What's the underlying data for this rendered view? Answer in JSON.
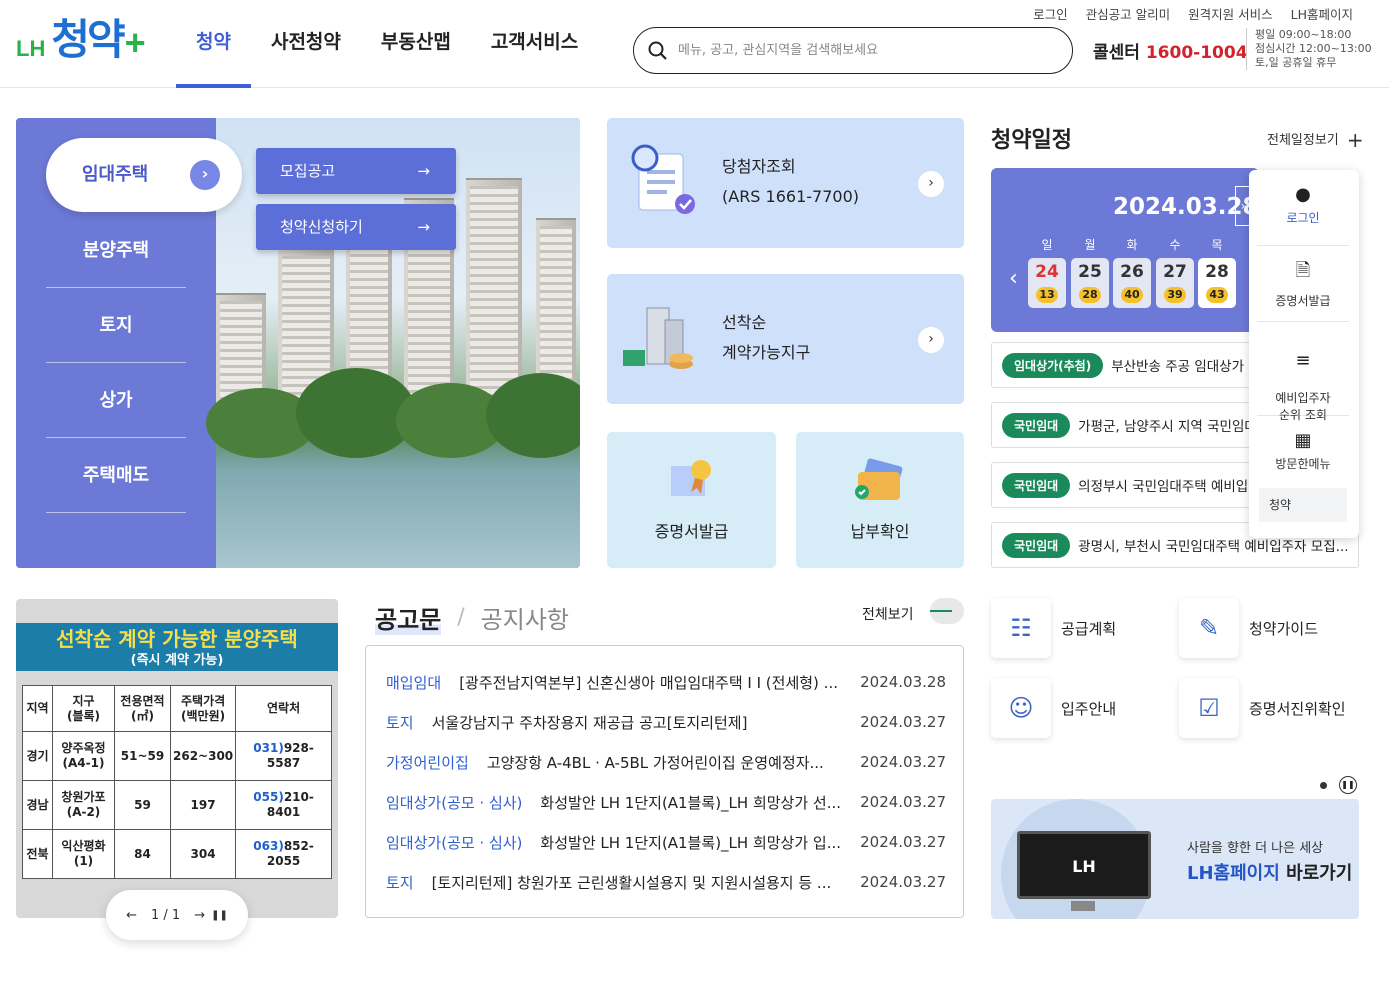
{
  "header": {
    "logo": {
      "prefix": "LH",
      "title": "청약",
      "suffix": "+"
    },
    "nav": [
      "청약",
      "사전청약",
      "부동산맵",
      "고객서비스"
    ],
    "util_links": [
      "로그인",
      "관심공고 알리미",
      "원격지원 서비스",
      "LH홈페이지"
    ],
    "search_placeholder": "메뉴, 공고, 관심지역을 검색해보세요",
    "callcenter_label": "콜센터",
    "callcenter_number": "1600-1004",
    "hours": [
      "평일 09:00~18:00",
      "점심시간 12:00~13:00",
      "토,일 공휴일 휴무"
    ]
  },
  "hero": {
    "tabs": [
      "임대주택",
      "분양주택",
      "토지",
      "상가",
      "주택매도"
    ],
    "buttons": [
      "모집공고",
      "청약신청하기"
    ],
    "arrow": "→",
    "chevron": "›"
  },
  "quick": {
    "winner": {
      "line1": "당첨자조회",
      "line2": "(ARS 1661-7700)"
    },
    "firstcome": {
      "line1": "선착순",
      "line2": "계약가능지구"
    },
    "cert": "증명서발급",
    "payment": "납부확인",
    "chevron": "›"
  },
  "schedule": {
    "title": "청약일정",
    "view_all": "전체일정보기",
    "plus": "+",
    "date": "2024.03.28",
    "prev": "‹",
    "next": "›",
    "weekdays": [
      "일",
      "월",
      "화",
      "수",
      "목"
    ],
    "days": [
      {
        "day": "24",
        "count": "13"
      },
      {
        "day": "25",
        "count": "28"
      },
      {
        "day": "26",
        "count": "40"
      },
      {
        "day": "27",
        "count": "39"
      },
      {
        "day": "28",
        "count": "43"
      }
    ],
    "notices": [
      {
        "badge": "임대상가(추첨)",
        "text": "부산반송 주공 임대상가 입"
      },
      {
        "badge": "국민임대",
        "text": "가평군, 남양주시 지역 국민임대"
      },
      {
        "badge": "국민임대",
        "text": "의정부시 국민임대주택 예비입주"
      },
      {
        "badge": "국민임대",
        "text": "광명시, 부천시 국민임대주택 예비입주자 모집..."
      }
    ]
  },
  "side_menu": {
    "items": [
      "로그인",
      "증명서발급",
      "예비입주자\n순위 조회",
      "방문한메뉴"
    ],
    "recent": "청약"
  },
  "promo": {
    "title": "선착순 계약 가능한 분양주택",
    "subtitle": "(즉시 계약 가능)",
    "headers": [
      "지역",
      "지구\n(블록)",
      "전용면적\n(㎡)",
      "주택가격\n(백만원)",
      "연락처"
    ],
    "rows": [
      {
        "region": "경기",
        "block": "양주옥정\n(A4-1)",
        "area": "51~59",
        "price": "262~300",
        "area_code": "031)",
        "phone": "928-5587"
      },
      {
        "region": "경남",
        "block": "창원가포\n(A-2)",
        "area": "59",
        "price": "197",
        "area_code": "055)",
        "phone": "210-8401"
      },
      {
        "region": "전북",
        "block": "익산평화\n(1)",
        "area": "84",
        "price": "304",
        "area_code": "063)",
        "phone": "852-2055"
      }
    ],
    "pager": "1 / 1",
    "prev": "←",
    "next": "→",
    "pause": "❚❚"
  },
  "board": {
    "tabs": [
      "공고문",
      "공지사항"
    ],
    "separator": "/",
    "view_all": "전체보기",
    "rows": [
      {
        "category": "매입임대",
        "title": "[광주전남지역본부] 신혼신생아 매입임대주택 I I (전세형) ...",
        "date": "2024.03.28"
      },
      {
        "category": "토지",
        "title": "서울강남지구 주차장용지 재공급 공고[토지리턴제]",
        "date": "2024.03.27"
      },
      {
        "category": "가정어린이집",
        "title": "고양장항 A-4BL · A-5BL 가정어린이집 운영예정자...",
        "date": "2024.03.27"
      },
      {
        "category": "임대상가(공모 · 심사)",
        "title": "화성발안 LH 1단지(A1블록)_LH 희망상가 선...",
        "date": "2024.03.27"
      },
      {
        "category": "임대상가(공모 · 심사)",
        "title": "화성발안 LH 1단지(A1블록)_LH 희망상가 입...",
        "date": "2024.03.27"
      },
      {
        "category": "토지",
        "title": "[토지리턴제] 창원가포 근린생활시설용지 및 지원시설용지 등 ...",
        "date": "2024.03.27"
      }
    ]
  },
  "shortcuts": [
    "공급계획",
    "청약가이드",
    "입주안내",
    "증명서진위확인"
  ],
  "banner": {
    "line1": "사람을 향한 더 나은 세상",
    "line2_highlight": "LH홈페이지",
    "line2_rest": "바로가기",
    "monitor_text": "LH"
  },
  "colors": {
    "accent": "#3e5fd6",
    "hero": "#6c79d6",
    "badge": "#1a8a5a",
    "call": "#d3222b"
  }
}
